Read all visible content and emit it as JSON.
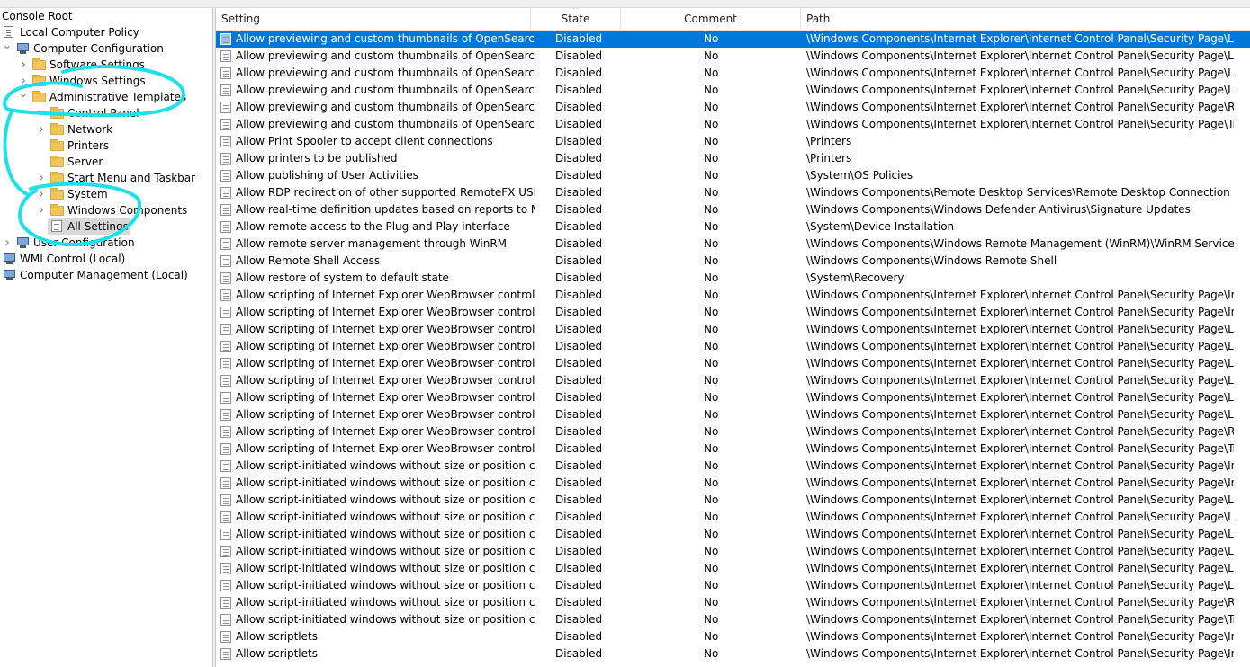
{
  "tree": {
    "items": [
      {
        "label": "Console Root",
        "indent": 0,
        "expander": "",
        "icon": "none"
      },
      {
        "label": "Local Computer Policy",
        "indent": 0,
        "expander": "",
        "icon": "policy"
      },
      {
        "label": "Computer Configuration",
        "indent": 1,
        "expander": "open",
        "icon": "computer"
      },
      {
        "label": "Software Settings",
        "indent": 2,
        "expander": "closed",
        "icon": "folder"
      },
      {
        "label": "Windows Settings",
        "indent": 2,
        "expander": "closed",
        "icon": "folder"
      },
      {
        "label": "Administrative Templates",
        "indent": 2,
        "expander": "open",
        "icon": "folder"
      },
      {
        "label": "Control Panel",
        "indent": 3,
        "expander": "closed",
        "icon": "folder"
      },
      {
        "label": "Network",
        "indent": 3,
        "expander": "closed",
        "icon": "folder"
      },
      {
        "label": "Printers",
        "indent": 3,
        "expander": "",
        "icon": "folder"
      },
      {
        "label": "Server",
        "indent": 3,
        "expander": "",
        "icon": "folder"
      },
      {
        "label": "Start Menu and Taskbar",
        "indent": 3,
        "expander": "closed",
        "icon": "folder"
      },
      {
        "label": "System",
        "indent": 3,
        "expander": "closed",
        "icon": "folder"
      },
      {
        "label": "Windows Components",
        "indent": 3,
        "expander": "closed",
        "icon": "folder"
      },
      {
        "label": "All Settings",
        "indent": 3,
        "expander": "",
        "icon": "allsettings",
        "selected": true
      },
      {
        "label": "User Configuration",
        "indent": 1,
        "expander": "closed",
        "icon": "computer"
      },
      {
        "label": "WMI Control (Local)",
        "indent": 0,
        "expander": "",
        "icon": "computer"
      },
      {
        "label": "Computer Management (Local)",
        "indent": 0,
        "expander": "",
        "icon": "computer"
      }
    ]
  },
  "columns": {
    "setting": "Setting",
    "state": "State",
    "comment": "Comment",
    "path": "Path",
    "sort_indicator": "^"
  },
  "rows": [
    {
      "setting": "Allow previewing and custom thumbnails of OpenSearch q...",
      "state": "Disabled",
      "comment": "No",
      "path": "\\Windows Components\\Internet Explorer\\Internet Control Panel\\Security Page\\Locked-...",
      "selected": true
    },
    {
      "setting": "Allow previewing and custom thumbnails of OpenSearch q...",
      "state": "Disabled",
      "comment": "No",
      "path": "\\Windows Components\\Internet Explorer\\Internet Control Panel\\Security Page\\Locked-..."
    },
    {
      "setting": "Allow previewing and custom thumbnails of OpenSearch q...",
      "state": "Disabled",
      "comment": "No",
      "path": "\\Windows Components\\Internet Explorer\\Internet Control Panel\\Security Page\\Locked-..."
    },
    {
      "setting": "Allow previewing and custom thumbnails of OpenSearch q...",
      "state": "Disabled",
      "comment": "No",
      "path": "\\Windows Components\\Internet Explorer\\Internet Control Panel\\Security Page\\Locked-..."
    },
    {
      "setting": "Allow previewing and custom thumbnails of OpenSearch q...",
      "state": "Disabled",
      "comment": "No",
      "path": "\\Windows Components\\Internet Explorer\\Internet Control Panel\\Security Page\\Restricte..."
    },
    {
      "setting": "Allow previewing and custom thumbnails of OpenSearch q...",
      "state": "Disabled",
      "comment": "No",
      "path": "\\Windows Components\\Internet Explorer\\Internet Control Panel\\Security Page\\Trusted S..."
    },
    {
      "setting": "Allow Print Spooler to accept client connections",
      "state": "Disabled",
      "comment": "No",
      "path": "\\Printers"
    },
    {
      "setting": "Allow printers to be published",
      "state": "Disabled",
      "comment": "No",
      "path": "\\Printers"
    },
    {
      "setting": "Allow publishing of User Activities",
      "state": "Disabled",
      "comment": "No",
      "path": "\\System\\OS Policies"
    },
    {
      "setting": "Allow RDP redirection of other supported RemoteFX USB de...",
      "state": "Disabled",
      "comment": "No",
      "path": "\\Windows Components\\Remote Desktop Services\\Remote Desktop Connection Client\\R..."
    },
    {
      "setting": "Allow real-time definition updates based on reports to Micr...",
      "state": "Disabled",
      "comment": "No",
      "path": "\\Windows Components\\Windows Defender Antivirus\\Signature Updates"
    },
    {
      "setting": "Allow remote access to the Plug and Play interface",
      "state": "Disabled",
      "comment": "No",
      "path": "\\System\\Device Installation"
    },
    {
      "setting": "Allow remote server management through WinRM",
      "state": "Disabled",
      "comment": "No",
      "path": "\\Windows Components\\Windows Remote Management (WinRM)\\WinRM Service"
    },
    {
      "setting": "Allow Remote Shell Access",
      "state": "Disabled",
      "comment": "No",
      "path": "\\Windows Components\\Windows Remote Shell"
    },
    {
      "setting": "Allow restore of system to default state",
      "state": "Disabled",
      "comment": "No",
      "path": "\\System\\Recovery"
    },
    {
      "setting": "Allow scripting of Internet Explorer WebBrowser controls",
      "state": "Disabled",
      "comment": "No",
      "path": "\\Windows Components\\Internet Explorer\\Internet Control Panel\\Security Page\\Internet ..."
    },
    {
      "setting": "Allow scripting of Internet Explorer WebBrowser controls",
      "state": "Disabled",
      "comment": "No",
      "path": "\\Windows Components\\Internet Explorer\\Internet Control Panel\\Security Page\\Intranet ..."
    },
    {
      "setting": "Allow scripting of Internet Explorer WebBrowser controls",
      "state": "Disabled",
      "comment": "No",
      "path": "\\Windows Components\\Internet Explorer\\Internet Control Panel\\Security Page\\Local Ma..."
    },
    {
      "setting": "Allow scripting of Internet Explorer WebBrowser controls",
      "state": "Disabled",
      "comment": "No",
      "path": "\\Windows Components\\Internet Explorer\\Internet Control Panel\\Security Page\\Locked-..."
    },
    {
      "setting": "Allow scripting of Internet Explorer WebBrowser controls",
      "state": "Disabled",
      "comment": "No",
      "path": "\\Windows Components\\Internet Explorer\\Internet Control Panel\\Security Page\\Locked-..."
    },
    {
      "setting": "Allow scripting of Internet Explorer WebBrowser controls",
      "state": "Disabled",
      "comment": "No",
      "path": "\\Windows Components\\Internet Explorer\\Internet Control Panel\\Security Page\\Locked-..."
    },
    {
      "setting": "Allow scripting of Internet Explorer WebBrowser controls",
      "state": "Disabled",
      "comment": "No",
      "path": "\\Windows Components\\Internet Explorer\\Internet Control Panel\\Security Page\\Locked-..."
    },
    {
      "setting": "Allow scripting of Internet Explorer WebBrowser controls",
      "state": "Disabled",
      "comment": "No",
      "path": "\\Windows Components\\Internet Explorer\\Internet Control Panel\\Security Page\\Locked-..."
    },
    {
      "setting": "Allow scripting of Internet Explorer WebBrowser controls",
      "state": "Disabled",
      "comment": "No",
      "path": "\\Windows Components\\Internet Explorer\\Internet Control Panel\\Security Page\\Restricte..."
    },
    {
      "setting": "Allow scripting of Internet Explorer WebBrowser controls",
      "state": "Disabled",
      "comment": "No",
      "path": "\\Windows Components\\Internet Explorer\\Internet Control Panel\\Security Page\\Trusted S..."
    },
    {
      "setting": "Allow script-initiated windows without size or position cons...",
      "state": "Disabled",
      "comment": "No",
      "path": "\\Windows Components\\Internet Explorer\\Internet Control Panel\\Security Page\\Internet ..."
    },
    {
      "setting": "Allow script-initiated windows without size or position cons...",
      "state": "Disabled",
      "comment": "No",
      "path": "\\Windows Components\\Internet Explorer\\Internet Control Panel\\Security Page\\Intranet ..."
    },
    {
      "setting": "Allow script-initiated windows without size or position cons...",
      "state": "Disabled",
      "comment": "No",
      "path": "\\Windows Components\\Internet Explorer\\Internet Control Panel\\Security Page\\Local Ma..."
    },
    {
      "setting": "Allow script-initiated windows without size or position cons...",
      "state": "Disabled",
      "comment": "No",
      "path": "\\Windows Components\\Internet Explorer\\Internet Control Panel\\Security Page\\Locked-..."
    },
    {
      "setting": "Allow script-initiated windows without size or position cons...",
      "state": "Disabled",
      "comment": "No",
      "path": "\\Windows Components\\Internet Explorer\\Internet Control Panel\\Security Page\\Locked-..."
    },
    {
      "setting": "Allow script-initiated windows without size or position cons...",
      "state": "Disabled",
      "comment": "No",
      "path": "\\Windows Components\\Internet Explorer\\Internet Control Panel\\Security Page\\Locked-..."
    },
    {
      "setting": "Allow script-initiated windows without size or position cons...",
      "state": "Disabled",
      "comment": "No",
      "path": "\\Windows Components\\Internet Explorer\\Internet Control Panel\\Security Page\\Locked-..."
    },
    {
      "setting": "Allow script-initiated windows without size or position cons...",
      "state": "Disabled",
      "comment": "No",
      "path": "\\Windows Components\\Internet Explorer\\Internet Control Panel\\Security Page\\Locked-..."
    },
    {
      "setting": "Allow script-initiated windows without size or position cons...",
      "state": "Disabled",
      "comment": "No",
      "path": "\\Windows Components\\Internet Explorer\\Internet Control Panel\\Security Page\\Restricte..."
    },
    {
      "setting": "Allow script-initiated windows without size or position cons...",
      "state": "Disabled",
      "comment": "No",
      "path": "\\Windows Components\\Internet Explorer\\Internet Control Panel\\Security Page\\Trusted S..."
    },
    {
      "setting": "Allow scriptlets",
      "state": "Disabled",
      "comment": "No",
      "path": "\\Windows Components\\Internet Explorer\\Internet Control Panel\\Security Page\\Internet ..."
    },
    {
      "setting": "Allow scriptlets",
      "state": "Disabled",
      "comment": "No",
      "path": "\\Windows Components\\Internet Explorer\\Internet Control Panel\\Security Page\\Intranet ..."
    }
  ],
  "colors": {
    "selection": "#0078d7",
    "annotation": "#1ee0e6",
    "tree_selected": "#d9d9d9"
  },
  "icons": {
    "expander_open": "chevron-down-icon",
    "expander_closed": "chevron-right-icon",
    "folder": "folder-icon",
    "computer": "computer-icon",
    "policy": "policy-icon",
    "setting": "setting-page-icon"
  }
}
